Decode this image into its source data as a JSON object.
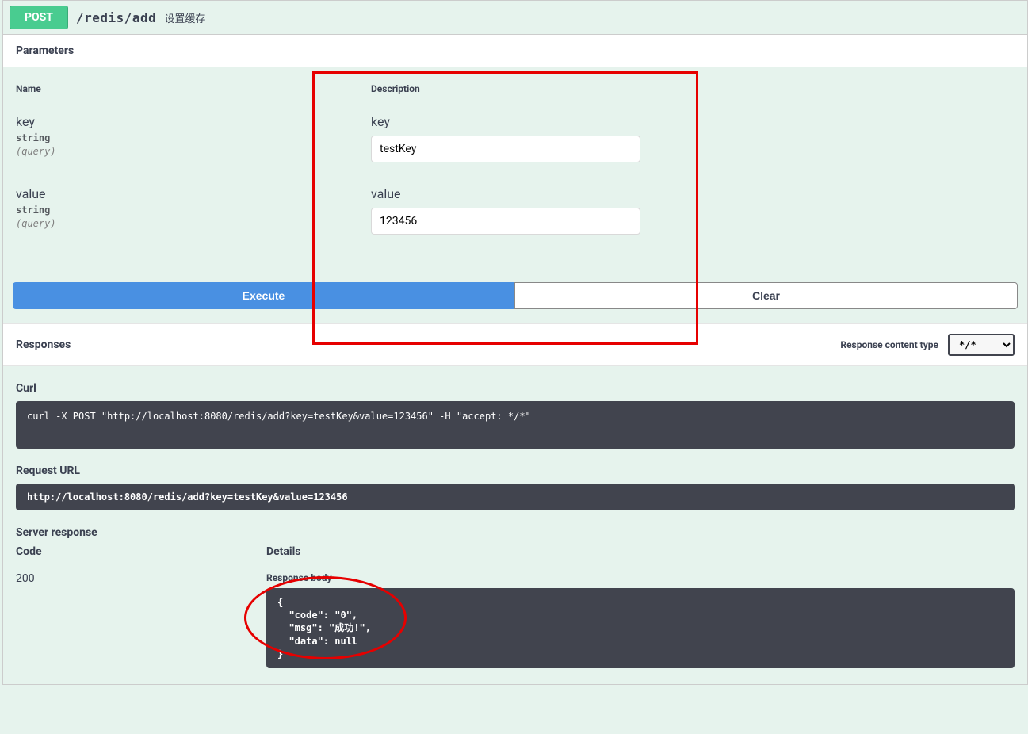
{
  "method": "POST",
  "endpoint": "/redis/add",
  "endpoint_desc": "设置缓存",
  "parameters": {
    "title": "Parameters",
    "headers": {
      "name": "Name",
      "desc": "Description"
    },
    "rows": [
      {
        "name": "key",
        "type": "string",
        "loc": "(query)",
        "label": "key",
        "value": "testKey"
      },
      {
        "name": "value",
        "type": "string",
        "loc": "(query)",
        "label": "value",
        "value": "123456"
      }
    ]
  },
  "buttons": {
    "execute": "Execute",
    "clear": "Clear"
  },
  "responses": {
    "title": "Responses",
    "content_type_label": "Response content type",
    "content_type_value": "*/*",
    "curl_title": "Curl",
    "curl_text": "curl -X POST \"http://localhost:8080/redis/add?key=testKey&value=123456\" -H \"accept: */*\"",
    "request_url_title": "Request URL",
    "request_url": "http://localhost:8080/redis/add?key=testKey&value=123456",
    "server_response_title": "Server response",
    "code_header": "Code",
    "details_header": "Details",
    "code": "200",
    "response_body_label": "Response body",
    "response_body": "{\n  \"code\": \"0\",\n  \"msg\": \"成功!\",\n  \"data\": null\n}"
  }
}
